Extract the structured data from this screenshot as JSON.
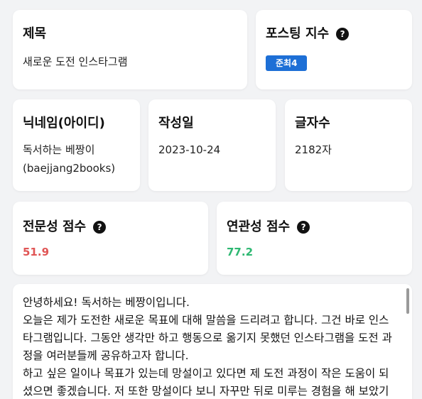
{
  "title_card": {
    "label": "제목",
    "value": "새로운 도전 인스타그램"
  },
  "posting_index": {
    "label": "포스팅 지수",
    "badge": "준최4",
    "badge_color": "#1d6fd6"
  },
  "nickname_card": {
    "label": "닉네임(아이디)",
    "line1": "독서하는 베짱이",
    "line2": "(baejjang2books)"
  },
  "date_card": {
    "label": "작성일",
    "value": "2023-10-24"
  },
  "chars_card": {
    "label": "글자수",
    "value": "2182자"
  },
  "expertise": {
    "label": "전문성 점수",
    "score": "51.9",
    "score_color": "#e05555"
  },
  "relevance": {
    "label": "연관성 점수",
    "score": "77.2",
    "score_color": "#2eb872"
  },
  "help_icon_glyph": "?",
  "post": {
    "lines": [
      "안녕하세요! 독서하는 베짱이입니다.",
      "오늘은 제가 도전한 새로운 목표에 대해 말씀을 드리려고 합니다. 그건 바로 인스타그램입니다. 그동안 생각만 하고 행동으로 옮기지 못했던 인스타그램을 도전 과정을 여러분들께 공유하고자 합니다.",
      "하고 싶은 일이나 목표가 있는데 망설이고 있다면 제 도전 과정이 작은 도움이 되셨으면 좋겠습니다. 저 또한 망설이다 보니 자꾸만 뒤로 미루는 경험을 해 보았기"
    ]
  }
}
